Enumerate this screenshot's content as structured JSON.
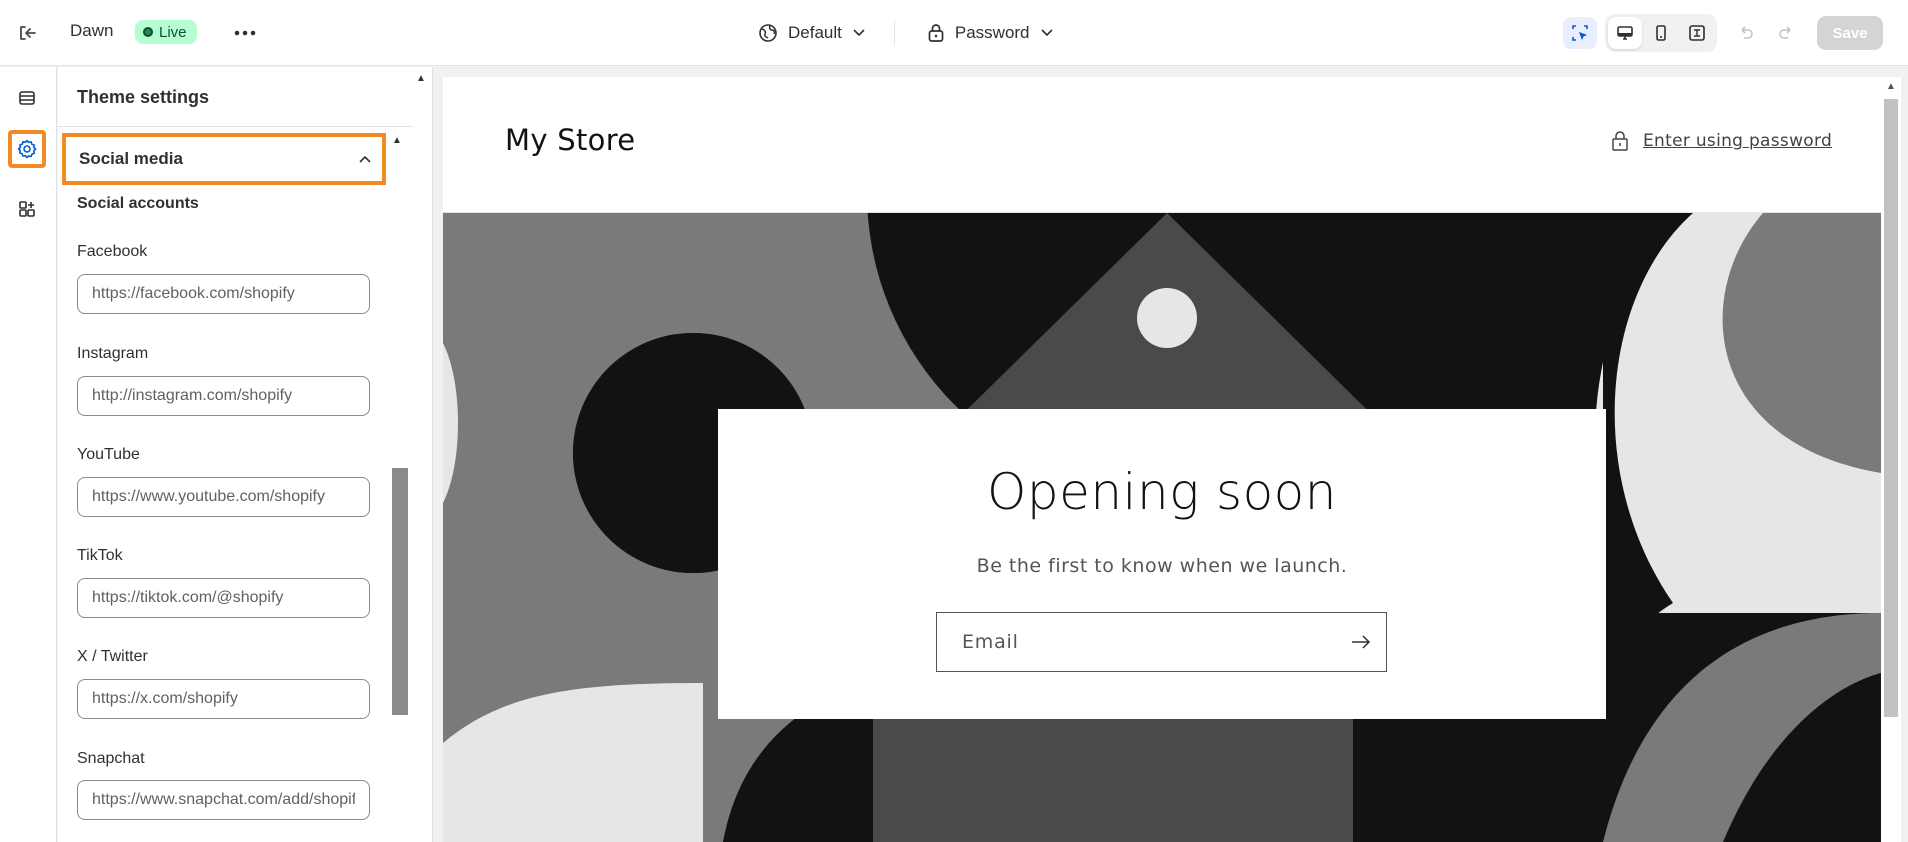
{
  "topbar": {
    "theme_name": "Dawn",
    "status": "Live",
    "template": "Default",
    "page_select": "Password",
    "save_label": "Save"
  },
  "panel": {
    "title": "Theme settings",
    "section_title": "Social media",
    "subheading": "Social accounts",
    "fields": [
      {
        "label": "Facebook",
        "value": "https://facebook.com/shopify"
      },
      {
        "label": "Instagram",
        "value": "http://instagram.com/shopify"
      },
      {
        "label": "YouTube",
        "value": "https://www.youtube.com/shopify"
      },
      {
        "label": "TikTok",
        "value": "https://tiktok.com/@shopify"
      },
      {
        "label": "X / Twitter",
        "value": "https://x.com/shopify"
      },
      {
        "label": "Snapchat",
        "value": "https://www.snapchat.com/add/shopify"
      }
    ]
  },
  "preview": {
    "store_name": "My Store",
    "enter_password": "Enter using password",
    "hero_title": "Opening soon",
    "hero_subtitle": "Be the first to know when we launch.",
    "email_placeholder": "Email"
  },
  "colors": {
    "accent_highlight": "#f08a24",
    "live_badge_bg": "#b4fed2",
    "active_icon": "#005bd3",
    "hero_dark": "#121212",
    "hero_mid": "#7a7a7a",
    "hero_light": "#e6e6e6"
  },
  "icons": {
    "exit": "exit-icon",
    "more": "more-horizontal-icon",
    "globe": "globe-icon",
    "lock": "lock-icon",
    "inspector": "selection-icon",
    "desktop": "desktop-icon",
    "mobile": "mobile-icon",
    "fullscreen": "fullscreen-icon",
    "undo": "undo-icon",
    "redo": "redo-icon",
    "sections": "sections-icon",
    "settings": "gear-icon",
    "apps": "apps-icon",
    "arrow": "arrow-right-icon"
  }
}
